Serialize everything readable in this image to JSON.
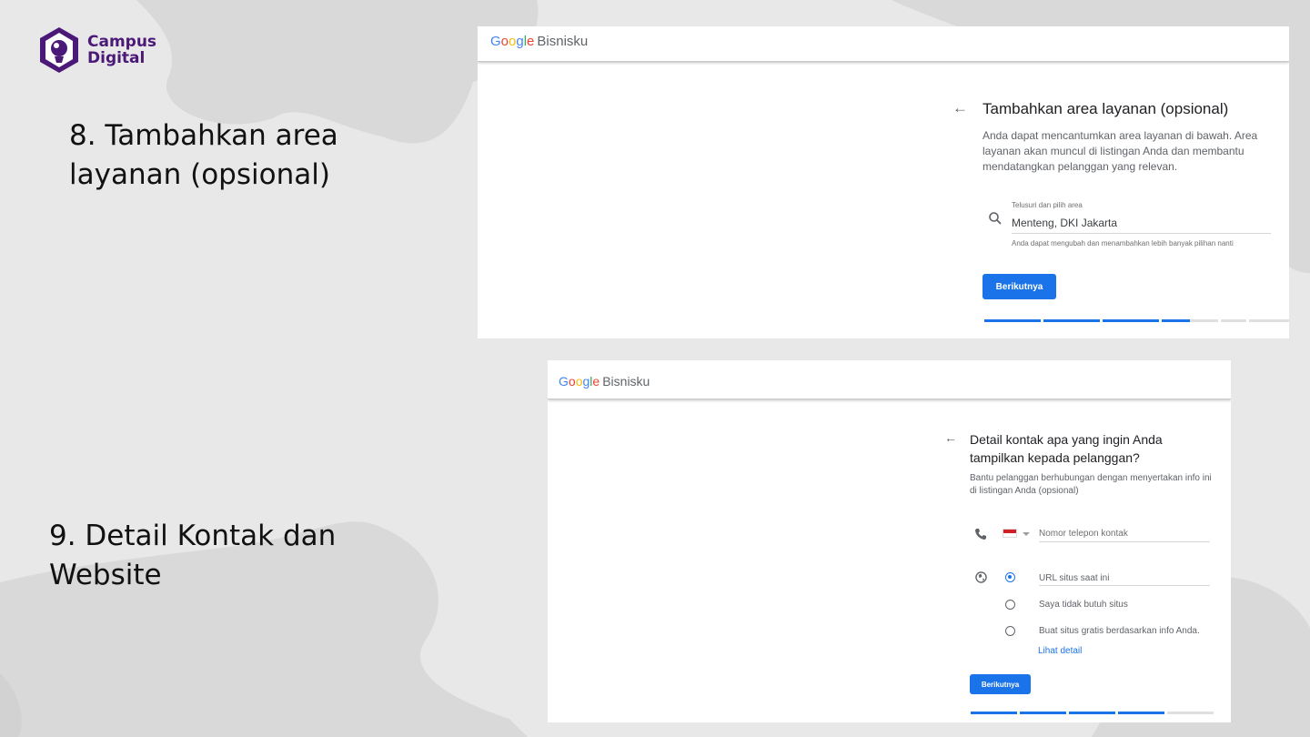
{
  "logo": {
    "line1": "Campus",
    "line2": "Digital"
  },
  "captions": {
    "step8": "8. Tambahkan area layanan (opsional)",
    "step9_line1": "9. Detail Kontak dan",
    "step9_line2": "Website"
  },
  "brand": {
    "google": [
      "G",
      "o",
      "o",
      "g",
      "l",
      "e"
    ],
    "product": "Bisnisku"
  },
  "screen1": {
    "title": "Tambahkan area layanan (opsional)",
    "description": "Anda dapat mencantumkan area layanan di bawah. Area layanan akan muncul di listingan Anda dan membantu mendatangkan pelanggan yang relevan.",
    "search_label": "Telusuri dan pilih area",
    "search_value": "Menteng, DKI Jakarta",
    "hint": "Anda dapat mengubah dan menambahkan lebih banyak pilihan nanti",
    "next_button": "Berikutnya",
    "progress": [
      1,
      1,
      1,
      0.5,
      0,
      0
    ]
  },
  "screen2": {
    "title": "Detail kontak apa yang ingin Anda tampilkan kepada pelanggan?",
    "description": "Bantu pelanggan berhubungan dengan menyertakan info ini di listingan Anda (opsional)",
    "phone_placeholder": "Nomor telepon kontak",
    "options": [
      {
        "label": "URL situs saat ini",
        "selected": true
      },
      {
        "label": "Saya tidak butuh situs",
        "selected": false
      },
      {
        "label": "Buat situs gratis berdasarkan info Anda.",
        "selected": false
      }
    ],
    "detail_link": "Lihat detail",
    "next_button": "Berikutnya",
    "progress": [
      1,
      1,
      1,
      1,
      0
    ]
  },
  "icons": {
    "back": "arrow-left-icon",
    "search": "search-icon",
    "phone": "phone-icon",
    "globe": "globe-icon"
  },
  "colors": {
    "accent": "#1a73e8",
    "logo": "#4b1a78",
    "flag_red": "#d32027"
  }
}
